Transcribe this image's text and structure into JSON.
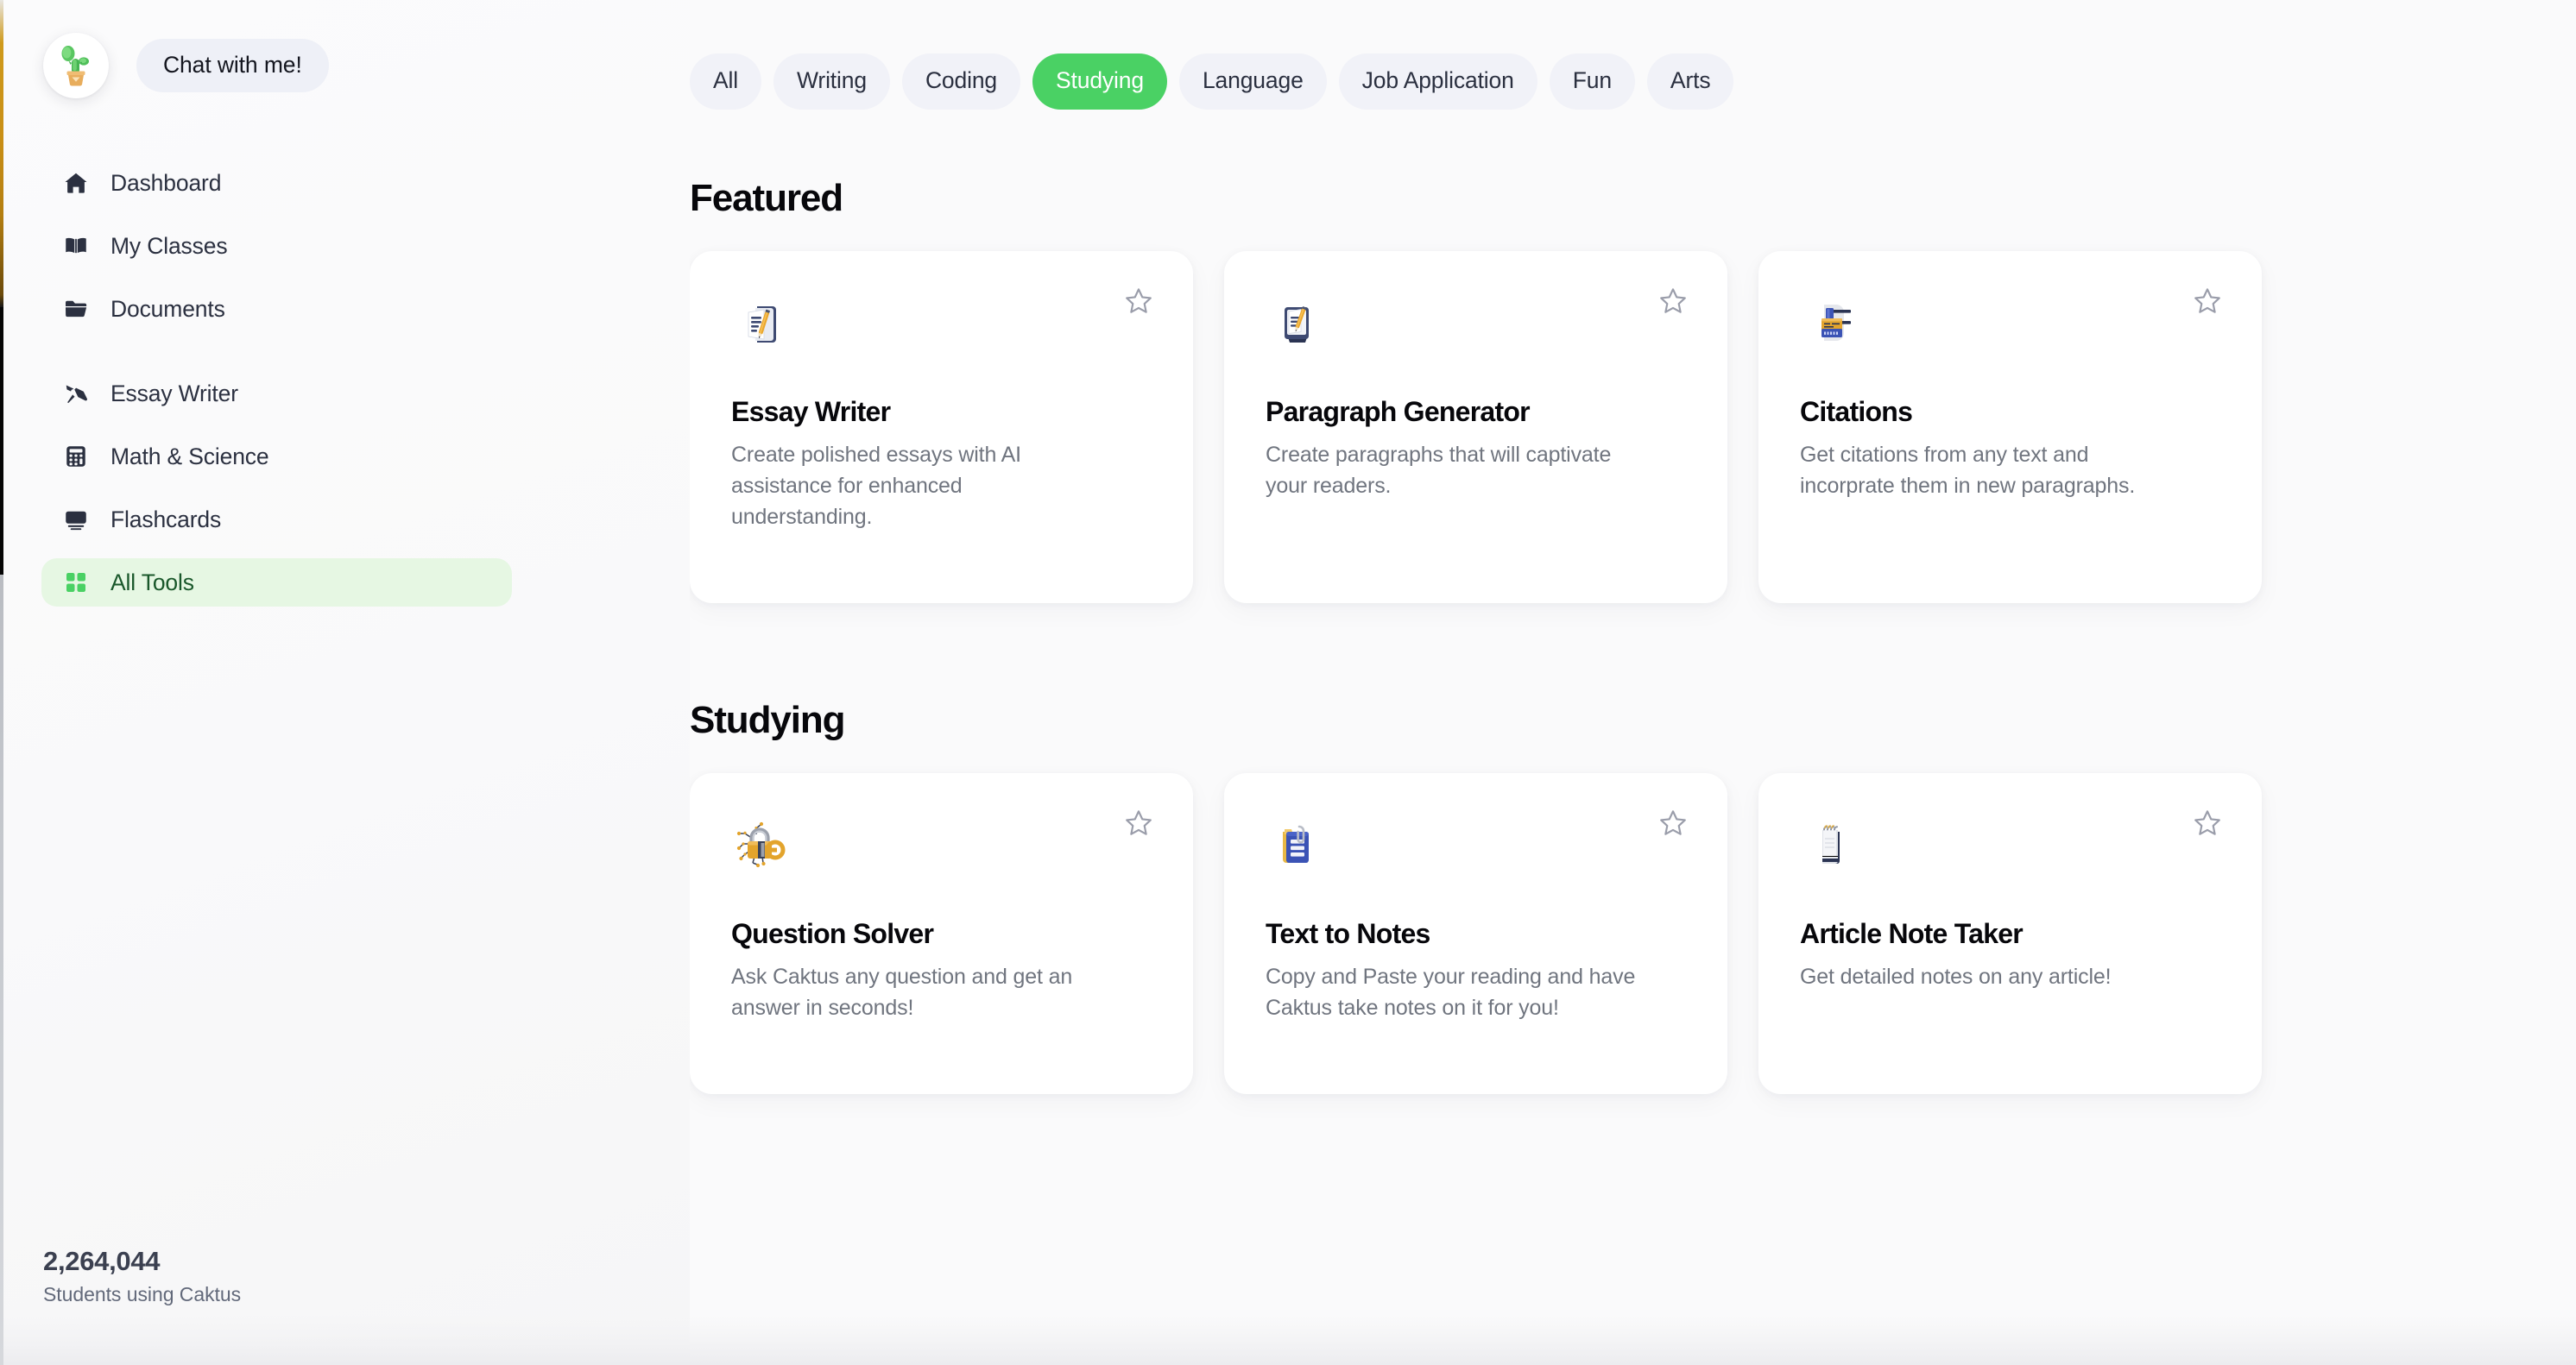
{
  "brand": {
    "avatar_icon": "cactus-plant-icon",
    "chat_button_label": "Chat with me!"
  },
  "colors": {
    "accent_green": "#4ad164",
    "active_nav_bg": "#e6f7e3",
    "active_nav_text": "#19572a",
    "tab_bg": "#f1f2f8",
    "page_bg": "#fafafb",
    "card_bg": "#ffffff",
    "title_text": "#07070b",
    "muted_text": "#70757f"
  },
  "sidebar": {
    "groups": [
      {
        "items": [
          {
            "label": "Dashboard",
            "icon": "home-icon",
            "active": false
          },
          {
            "label": "My Classes",
            "icon": "book-open-icon",
            "active": false
          },
          {
            "label": "Documents",
            "icon": "folder-icon",
            "active": false
          }
        ]
      },
      {
        "items": [
          {
            "label": "Essay Writer",
            "icon": "pen-nib-icon",
            "active": false
          },
          {
            "label": "Math & Science",
            "icon": "calculator-icon",
            "active": false
          },
          {
            "label": "Flashcards",
            "icon": "flashcards-icon",
            "active": false
          },
          {
            "label": "All Tools",
            "icon": "grid-squares-icon",
            "active": true
          }
        ]
      }
    ],
    "footer": {
      "stat_value": "2,264,044",
      "stat_label": "Students using Caktus"
    }
  },
  "tabs": [
    {
      "label": "All",
      "active": false
    },
    {
      "label": "Writing",
      "active": false
    },
    {
      "label": "Coding",
      "active": false
    },
    {
      "label": "Studying",
      "active": true
    },
    {
      "label": "Language",
      "active": false
    },
    {
      "label": "Job Application",
      "active": false
    },
    {
      "label": "Fun",
      "active": false
    },
    {
      "label": "Arts",
      "active": false
    }
  ],
  "sections": [
    {
      "title": "Featured",
      "cards": [
        {
          "title": "Essay Writer",
          "description": "Create polished essays with AI assistance for enhanced understanding.",
          "icon": "document-pencil-icon",
          "star": "star-outline-icon",
          "starred": false
        },
        {
          "title": "Paragraph Generator",
          "description": "Create paragraphs that will captivate your readers.",
          "icon": "monitor-pencil-icon",
          "star": "star-outline-icon",
          "starred": false
        },
        {
          "title": "Citations",
          "description": "Get citations from any text and incorprate them in new paragraphs.",
          "icon": "citation-books-icon",
          "star": "star-outline-icon",
          "starred": false
        }
      ]
    },
    {
      "title": "Studying",
      "cards": [
        {
          "title": "Question Solver",
          "description": "Ask Caktus any question and get an answer in seconds!",
          "icon": "padlock-key-icon",
          "star": "star-outline-icon",
          "starred": false
        },
        {
          "title": "Text to Notes",
          "description": "Copy and Paste your reading and have Caktus take notes on it for you!",
          "icon": "notes-clip-icon",
          "star": "star-outline-icon",
          "starred": false
        },
        {
          "title": "Article Note Taker",
          "description": "Get detailed notes on any article!",
          "icon": "spiral-notepad-icon",
          "star": "star-outline-icon",
          "starred": false
        }
      ]
    }
  ]
}
